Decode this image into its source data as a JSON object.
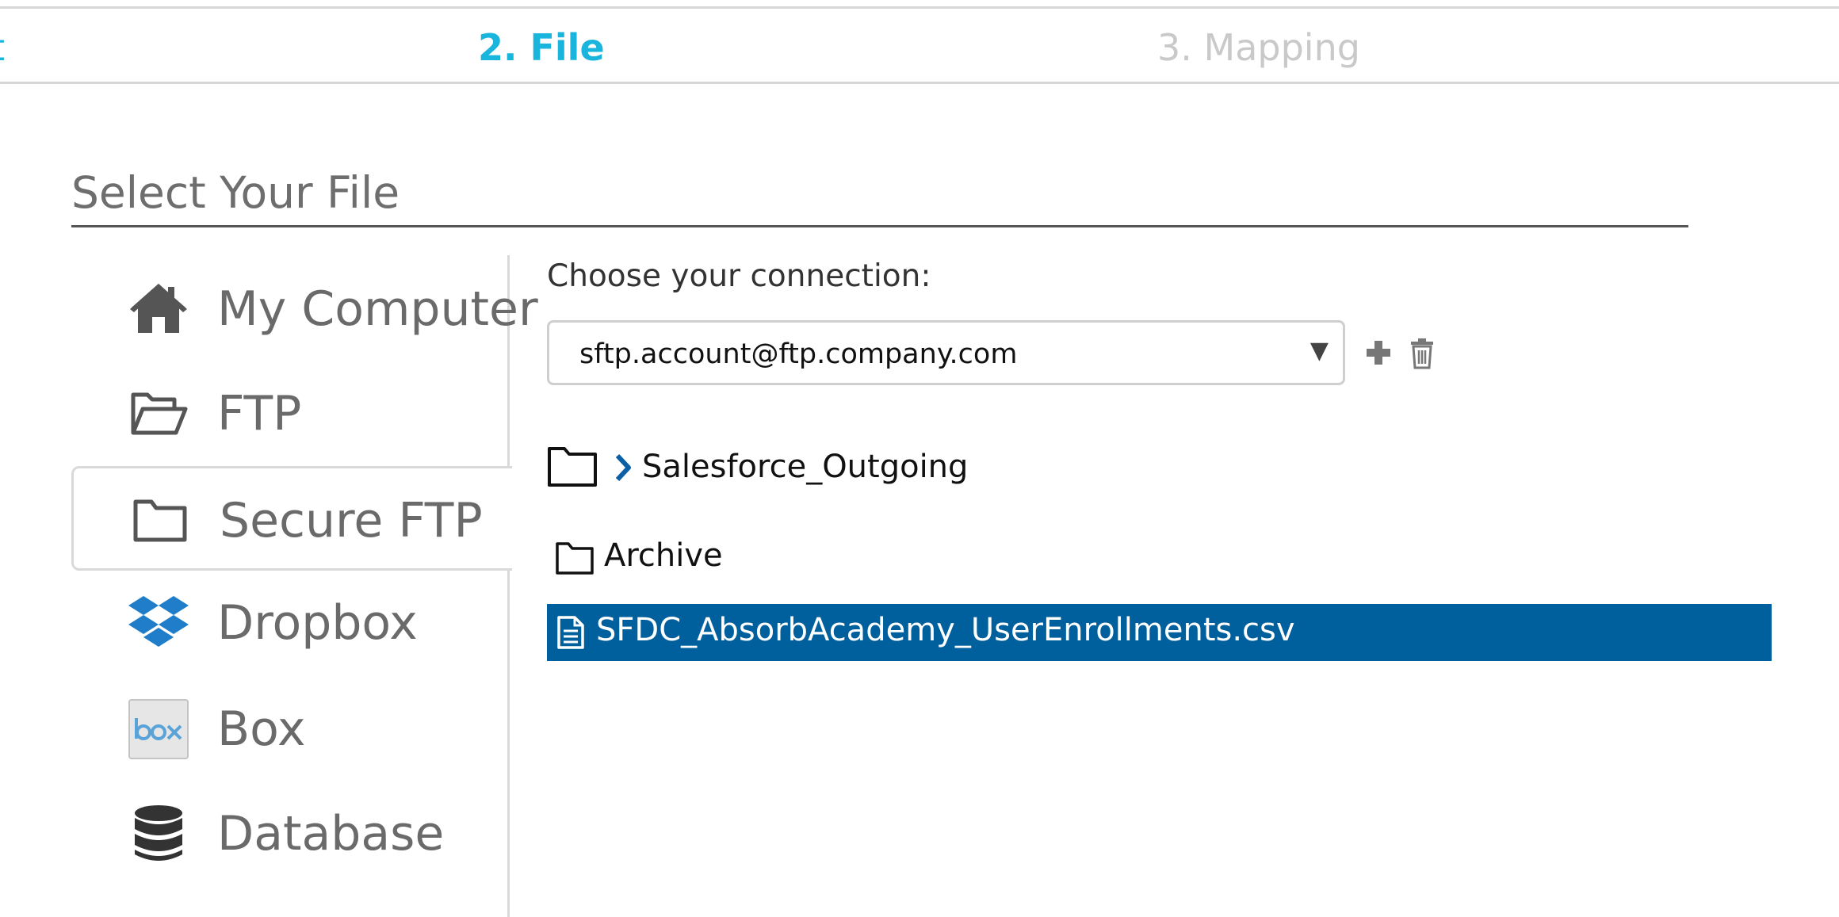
{
  "steps": {
    "prev_label": "t",
    "active_label": "2. File",
    "next_label": "3. Mapping"
  },
  "section": {
    "title": "Select Your File"
  },
  "sources": [
    {
      "label": "My Computer",
      "icon": "home-icon"
    },
    {
      "label": "FTP",
      "icon": "open-folder-icon"
    },
    {
      "label": "Secure FTP",
      "icon": "folder-icon",
      "selected": true
    },
    {
      "label": "Dropbox",
      "icon": "dropbox-icon"
    },
    {
      "label": "Box",
      "icon": "box-icon"
    },
    {
      "label": "Database",
      "icon": "database-icon"
    }
  ],
  "connection": {
    "label": "Choose your connection:",
    "selected_value": "sftp.account@ftp.company.com",
    "dropdown_arrow": "▼"
  },
  "tree": {
    "root_folder": "Salesforce_Outgoing",
    "child_folder": "Archive",
    "selected_file": "SFDC_AbsorbAcademy_UserEnrollments.csv"
  },
  "colors": {
    "accent": "#19b5dc",
    "selection": "#00609d",
    "dropbox": "#1f7dc9",
    "inactive_step": "#c9c9c9"
  }
}
